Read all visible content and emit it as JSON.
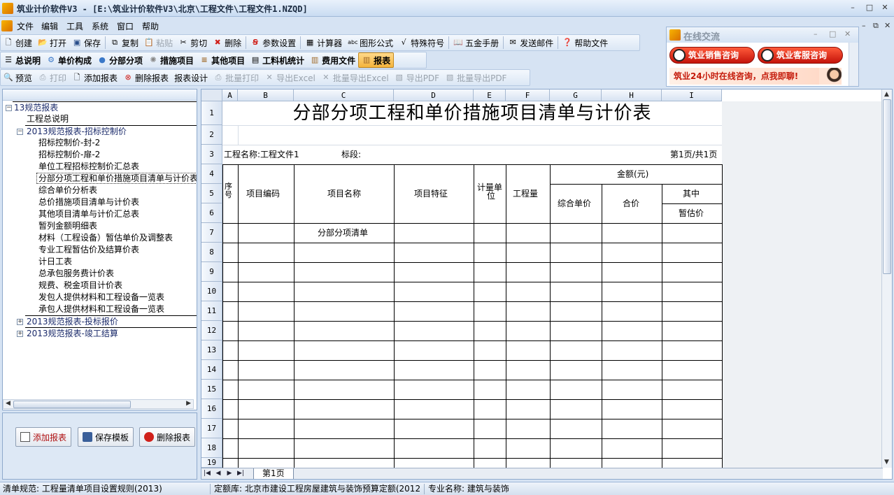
{
  "window": {
    "title": "筑业计价软件V3 - [E:\\筑业计价软件V3\\北京\\工程文件\\工程文件1.NZQD]",
    "controls": [
      "–",
      "□",
      "✕"
    ],
    "mdi_controls": [
      "–",
      "⧉",
      "✕"
    ]
  },
  "menu": [
    "文件",
    "编辑",
    "工具",
    "系统",
    "窗口",
    "帮助"
  ],
  "toolbar1": [
    {
      "label": "创建",
      "icon": "new-file-icon"
    },
    {
      "label": "打开",
      "icon": "open-folder-icon"
    },
    {
      "label": "保存",
      "icon": "save-icon"
    },
    {
      "label": "复制",
      "icon": "copy-icon"
    },
    {
      "label": "粘贴",
      "icon": "paste-icon",
      "disabled": true
    },
    {
      "label": "剪切",
      "icon": "scissors-icon"
    },
    {
      "label": "删除",
      "icon": "delete-x-icon"
    },
    {
      "label": "参数设置",
      "icon": "settings-icon"
    },
    {
      "label": "计算器",
      "icon": "calculator-icon"
    },
    {
      "label": "图形公式",
      "icon": "formula-icon"
    },
    {
      "label": "特殊符号",
      "icon": "symbol-icon"
    },
    {
      "label": "五金手册",
      "icon": "book-icon"
    },
    {
      "label": "发送邮件",
      "icon": "mail-icon"
    },
    {
      "label": "帮助文件",
      "icon": "help-icon"
    }
  ],
  "toolbar2": [
    {
      "label": "总说明",
      "icon": "list-icon"
    },
    {
      "label": "单价构成",
      "icon": "gear-drop-icon"
    },
    {
      "label": "分部分项",
      "icon": "drop-icon"
    },
    {
      "label": "措施项目",
      "icon": "cog-icon"
    },
    {
      "label": "其他项目",
      "icon": "stack-icon"
    },
    {
      "label": "工料机统计",
      "icon": "table-icon"
    },
    {
      "label": "费用文件",
      "icon": "fee-icon"
    },
    {
      "label": "报表",
      "icon": "report-icon",
      "active": true
    }
  ],
  "toolbar3": [
    {
      "label": "预览",
      "icon": "preview-icon"
    },
    {
      "label": "打印",
      "icon": "printer-icon",
      "disabled": true
    },
    {
      "label": "添加报表",
      "icon": "add-page-icon"
    },
    {
      "label": "删除报表",
      "icon": "delete-circle-icon"
    },
    {
      "label": "报表设计",
      "icon": ""
    },
    {
      "label": "批量打印",
      "icon": "batch-print-icon",
      "disabled": true
    },
    {
      "label": "导出Excel",
      "icon": "excel-icon",
      "disabled": true
    },
    {
      "label": "批量导出Excel",
      "icon": "excel-batch-icon",
      "disabled": true
    },
    {
      "label": "导出PDF",
      "icon": "pdf-icon",
      "disabled": true
    },
    {
      "label": "批量导出PDF",
      "icon": "pdf-batch-icon",
      "disabled": true
    }
  ],
  "chat": {
    "title": "在线交流",
    "sales_btn": "筑业销售咨询",
    "service_btn": "筑业客服咨询",
    "banner": "筑业24小时在线咨询，点我即聊!"
  },
  "tree": [
    {
      "label": "13规范报表",
      "level": 0,
      "toggle": "−",
      "hl": true
    },
    {
      "label": "工程总说明",
      "level": 1
    },
    {
      "label": "2013规范报表-招标控制价",
      "level": 1,
      "toggle": "−",
      "hl": true
    },
    {
      "label": "招标控制价-封-2",
      "level": 2
    },
    {
      "label": "招标控制价-扉-2",
      "level": 2
    },
    {
      "label": "单位工程招标控制价汇总表",
      "level": 2
    },
    {
      "label": "分部分项工程和单价措施项目清单与计价表",
      "level": 2,
      "selected": true
    },
    {
      "label": "综合单价分析表",
      "level": 2
    },
    {
      "label": "总价措施项目清单与计价表",
      "level": 2
    },
    {
      "label": "其他项目清单与计价汇总表",
      "level": 2
    },
    {
      "label": "暂列金额明细表",
      "level": 2
    },
    {
      "label": "材料（工程设备）暂估单价及调整表",
      "level": 2
    },
    {
      "label": "专业工程暂估价及结算价表",
      "level": 2
    },
    {
      "label": "计日工表",
      "level": 2
    },
    {
      "label": "总承包服务费计价表",
      "level": 2
    },
    {
      "label": "规费、税金项目计价表",
      "level": 2
    },
    {
      "label": "发包人提供材料和工程设备一览表",
      "level": 2
    },
    {
      "label": "承包人提供材料和工程设备一览表",
      "level": 2
    },
    {
      "label": "2013规范报表-投标报价",
      "level": 1,
      "toggle": "+",
      "hl": true
    },
    {
      "label": "2013规范报表-竣工结算",
      "level": 1,
      "toggle": "+",
      "hl": true
    }
  ],
  "left_buttons": {
    "add": "添加报表",
    "save": "保存模板",
    "delete": "删除报表"
  },
  "sheet": {
    "columns": [
      "A",
      "B",
      "C",
      "D",
      "E",
      "F",
      "G",
      "H",
      "I"
    ],
    "rows": [
      "1",
      "2",
      "3",
      "4",
      "5",
      "6",
      "7",
      "8",
      "9",
      "10",
      "11",
      "12",
      "13",
      "14",
      "15",
      "16",
      "17",
      "18",
      "19"
    ],
    "title": "分部分项工程和单价措施项目清单与计价表",
    "project_name": "工程名称:工程文件1",
    "section": "标段:",
    "page_info": "第1页/共1页",
    "headers": {
      "seq": "序号",
      "code": "项目编码",
      "name": "项目名称",
      "feature": "项目特征",
      "unit_l1": "计量单",
      "unit_l2": "位",
      "qty": "工程量",
      "amount": "金额(元)",
      "unit_price": "综合单价",
      "total": "合价",
      "of_which": "其中",
      "provisional": "暂估价"
    },
    "row7_name": "分部分项清单",
    "tab": "第1页"
  },
  "status": {
    "norm": "清单规范:  工程量清单项目设置规则(2013)",
    "quota": "定额库:  北京市建设工程房屋建筑与装饰预算定额(2012",
    "major": "专业名称:  建筑与装饰"
  }
}
